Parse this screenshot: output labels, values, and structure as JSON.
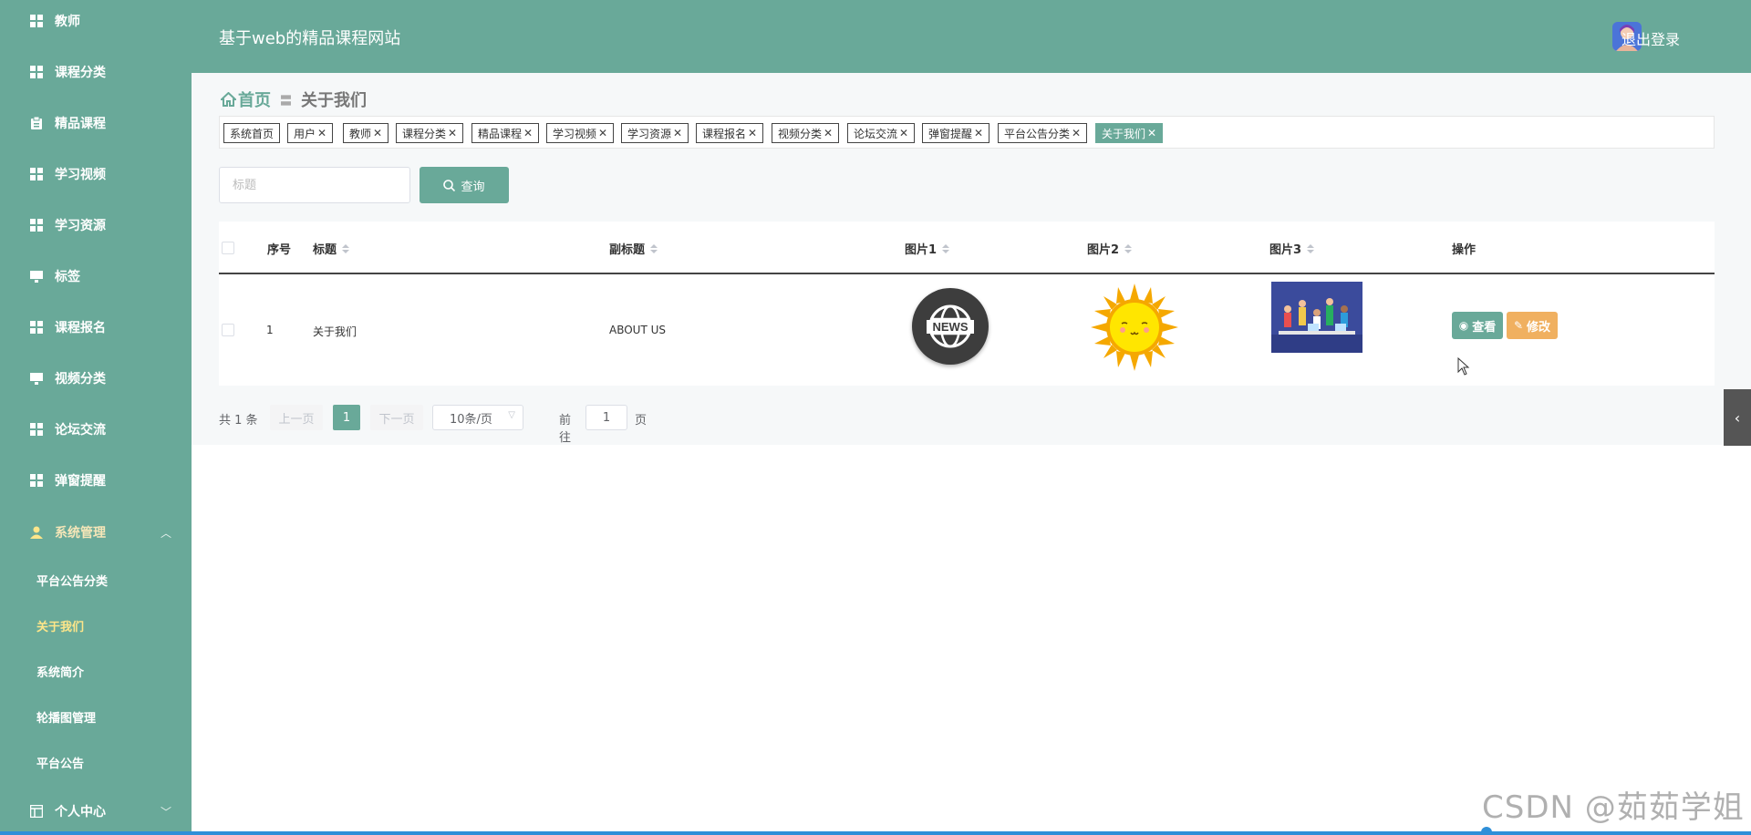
{
  "header": {
    "site_title": "基于web的精品课程网站",
    "logout_label": "退出登录"
  },
  "sidebar": {
    "items": [
      {
        "label": "教师",
        "icon": "grid-icon"
      },
      {
        "label": "课程分类",
        "icon": "grid-icon"
      },
      {
        "label": "精品课程",
        "icon": "clipboard-icon"
      },
      {
        "label": "学习视频",
        "icon": "grid-icon"
      },
      {
        "label": "学习资源",
        "icon": "grid-icon"
      },
      {
        "label": "标签",
        "icon": "monitor-icon"
      },
      {
        "label": "课程报名",
        "icon": "grid-icon"
      },
      {
        "label": "视频分类",
        "icon": "monitor-icon"
      },
      {
        "label": "论坛交流",
        "icon": "grid-icon"
      },
      {
        "label": "弹窗提醒",
        "icon": "grid-icon"
      },
      {
        "label": "系统管理",
        "icon": "user-icon"
      },
      {
        "label": "个人中心",
        "icon": "window-icon"
      }
    ],
    "system_sub": [
      {
        "label": "平台公告分类"
      },
      {
        "label": "关于我们",
        "active": true
      },
      {
        "label": "系统简介"
      },
      {
        "label": "轮播图管理"
      },
      {
        "label": "平台公告"
      }
    ]
  },
  "breadcrumb": {
    "home": "首页",
    "separator": "〓",
    "current": "关于我们"
  },
  "tags": [
    {
      "label": "系统首页",
      "closable": false
    },
    {
      "label": "用户",
      "closable": true
    },
    {
      "label": "教师",
      "closable": true
    },
    {
      "label": "课程分类",
      "closable": true
    },
    {
      "label": "精品课程",
      "closable": true
    },
    {
      "label": "学习视频",
      "closable": true
    },
    {
      "label": "学习资源",
      "closable": true
    },
    {
      "label": "课程报名",
      "closable": true
    },
    {
      "label": "视频分类",
      "closable": true
    },
    {
      "label": "论坛交流",
      "closable": true
    },
    {
      "label": "弹窗提醒",
      "closable": true
    },
    {
      "label": "平台公告分类",
      "closable": true
    },
    {
      "label": "关于我们",
      "closable": true,
      "active": true
    }
  ],
  "search": {
    "placeholder": "标题",
    "button_label": "查询"
  },
  "table": {
    "columns": [
      "序号",
      "标题",
      "副标题",
      "图片1",
      "图片2",
      "图片3",
      "操作"
    ],
    "rows": [
      {
        "index": "1",
        "title": "关于我们",
        "subtitle": "ABOUT US",
        "img1_text": "NEWS",
        "img1": "globe-news-icon",
        "img2": "sun-illustration",
        "img3": "team-illustration"
      }
    ],
    "actions": {
      "view": "查看",
      "edit": "修改"
    }
  },
  "pagination": {
    "total_text": "共 1 条",
    "prev": "上一页",
    "current": "1",
    "next": "下一页",
    "page_size": "10条/页",
    "goto_label": "前往",
    "goto_value": "1",
    "page_suffix": "页"
  },
  "watermark": "CSDN @茹茹学姐",
  "colors": {
    "primary": "#69a999",
    "edit_button": "#f0b060",
    "active_submenu": "#fde68a"
  }
}
